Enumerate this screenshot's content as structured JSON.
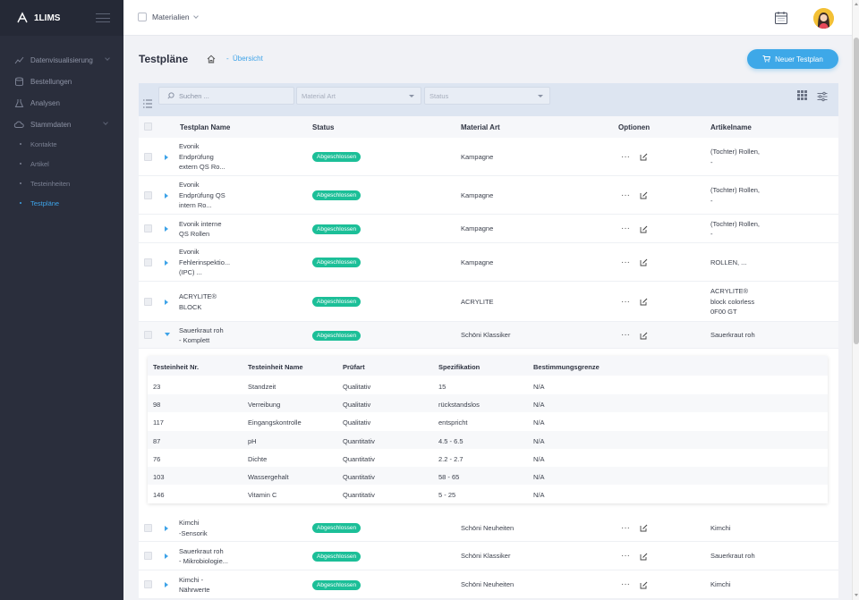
{
  "brand": {
    "name": "1LIMS"
  },
  "topbar": {
    "module": "Materialien"
  },
  "sidebar": {
    "items": [
      {
        "label": "Datenvisualisierung"
      },
      {
        "label": "Bestellungen"
      },
      {
        "label": "Analysen"
      },
      {
        "label": "Stammdaten"
      }
    ],
    "subitems": [
      {
        "label": "Kontakte"
      },
      {
        "label": "Artikel"
      },
      {
        "label": "Testeinheiten"
      },
      {
        "label": "Testpläne"
      }
    ]
  },
  "page": {
    "title": "Testpläne",
    "crumb_sep": "-",
    "crumb": "Übersicht",
    "new_button": "Neuer Testplan"
  },
  "filters": {
    "search_placeholder": "Suchen ...",
    "material_placeholder": "Material Art",
    "status_placeholder": "Status"
  },
  "table": {
    "headers": [
      "Testplan Name",
      "Status",
      "Material Art",
      "Optionen",
      "Artikelname"
    ],
    "options_label": "···",
    "rows": [
      {
        "name": [
          "Evonik",
          "Endprüfung",
          "extern QS Ro..."
        ],
        "status": "Abgeschlossen",
        "material": "Kampagne",
        "article": [
          "(Tochter) Rollen,",
          "-"
        ]
      },
      {
        "name": [
          "Evonik",
          "Endprüfung QS",
          "intern Ro..."
        ],
        "status": "Abgeschlossen",
        "material": "Kampagne",
        "article": [
          "(Tochter) Rollen,",
          "-"
        ]
      },
      {
        "name": [
          "Evonik interne",
          "QS Rollen"
        ],
        "status": "Abgeschlossen",
        "material": "Kampagne",
        "article": [
          "(Tochter) Rollen,",
          "-"
        ]
      },
      {
        "name": [
          "Evonik",
          "Fehlerinspektio...",
          "(IPC) ..."
        ],
        "status": "Abgeschlossen",
        "material": "Kampagne",
        "article": [
          "ROLLEN, ..."
        ]
      },
      {
        "name": [
          "ACRYLITE®",
          "BLOCK"
        ],
        "status": "Abgeschlossen",
        "material": "ACRYLITE",
        "article": [
          "ACRYLITE®",
          "block colorless",
          "0F00 GT"
        ]
      },
      {
        "name": [
          "Sauerkraut roh",
          "- Komplett"
        ],
        "status": "Abgeschlossen",
        "material": "Schöni Klassiker",
        "article": [
          "Sauerkraut roh"
        ]
      },
      {
        "name": [
          "Kimchi",
          "-Sensorik"
        ],
        "status": "Abgeschlossen",
        "material": "Schöni Neuheiten",
        "article": [
          "Kimchi"
        ]
      },
      {
        "name": [
          "Sauerkraut roh",
          "- Mikrobiologie..."
        ],
        "status": "Abgeschlossen",
        "material": "Schöni Klassiker",
        "article": [
          "Sauerkraut roh"
        ]
      },
      {
        "name": [
          "Kimchi -",
          "Nährwerte"
        ],
        "status": "Abgeschlossen",
        "material": "Schöni Neuheiten",
        "article": [
          "Kimchi"
        ]
      }
    ]
  },
  "subtable": {
    "headers": [
      "Testeinheit Nr.",
      "Testeinheit Name",
      "Prüfart",
      "Spezifikation",
      "Bestimmungsgrenze"
    ],
    "rows": [
      [
        "23",
        "Standzeit",
        "Qualitativ",
        "15",
        "N/A"
      ],
      [
        "98",
        "Verreibung",
        "Qualitativ",
        "rückstandslos",
        "N/A"
      ],
      [
        "117",
        "Eingangskontrolle",
        "Qualitativ",
        "entspricht",
        "N/A"
      ],
      [
        "87",
        "pH",
        "Quantitativ",
        "4.5 - 6.5",
        "N/A"
      ],
      [
        "76",
        "Dichte",
        "Quantitativ",
        "2.2 - 2.7",
        "N/A"
      ],
      [
        "103",
        "Wassergehalt",
        "Quantitativ",
        "58 - 65",
        "N/A"
      ],
      [
        "146",
        "Vitamin C",
        "Quantitativ",
        "5 - 25",
        "N/A"
      ]
    ]
  },
  "colors": {
    "accent": "#3ea8e8",
    "success": "#1cbf98",
    "sidebar": "#2a2e3c"
  }
}
